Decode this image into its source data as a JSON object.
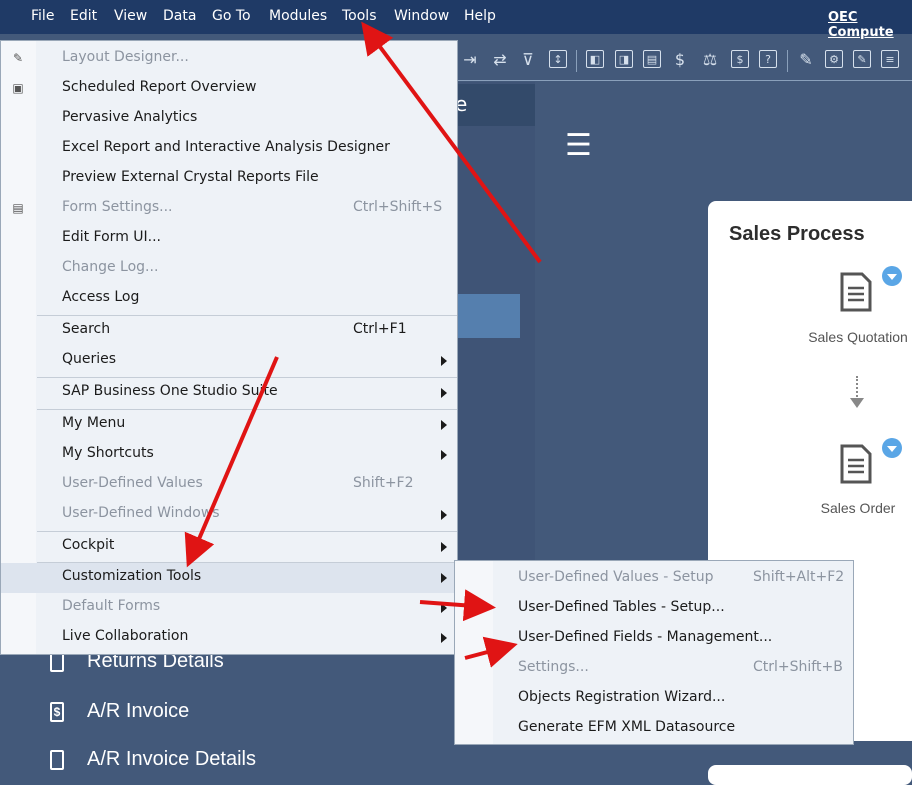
{
  "menubar": {
    "items": [
      {
        "label": "File"
      },
      {
        "label": "Edit"
      },
      {
        "label": "View"
      },
      {
        "label": "Data"
      },
      {
        "label": "Go To"
      },
      {
        "label": "Modules"
      },
      {
        "label": "Tools"
      },
      {
        "label": "Window"
      },
      {
        "label": "Help"
      }
    ],
    "company": "OEC Compute"
  },
  "colors": {
    "menubar_bg": "#1f3a66",
    "background": "#43597a",
    "menu_bg": "#eef2f7",
    "annotation_arrow": "#e01414",
    "badge": "#5aa6e6"
  },
  "tools_menu": {
    "items": [
      {
        "label": "Layout Designer...",
        "icon": "pencil-icon"
      },
      {
        "label": "Scheduled Report Overview",
        "icon": "report-schedule-icon"
      },
      {
        "label": "Pervasive Analytics"
      },
      {
        "label": "Excel Report and Interactive Analysis Designer"
      },
      {
        "label": "Preview External Crystal Reports File"
      },
      {
        "label": "Form Settings...",
        "shortcut": "Ctrl+Shift+S",
        "icon": "form-settings-icon"
      },
      {
        "label": "Edit Form UI..."
      },
      {
        "label": "Change Log..."
      },
      {
        "label": "Access Log"
      },
      {
        "label": "Search",
        "shortcut": "Ctrl+F1"
      },
      {
        "label": "Queries"
      },
      {
        "label": "SAP Business One Studio Suite"
      },
      {
        "label": "My Menu"
      },
      {
        "label": "My Shortcuts"
      },
      {
        "label": "User-Defined Values",
        "shortcut": "Shift+F2"
      },
      {
        "label": "User-Defined Windows"
      },
      {
        "label": "Cockpit"
      },
      {
        "label": "Customization Tools"
      },
      {
        "label": "Default Forms"
      },
      {
        "label": "Live Collaboration"
      }
    ]
  },
  "customization_submenu": {
    "items": [
      {
        "label": "User-Defined Values - Setup",
        "shortcut": "Shift+Alt+F2"
      },
      {
        "label": "User-Defined Tables - Setup..."
      },
      {
        "label": "User-Defined Fields - Management..."
      },
      {
        "label": "Settings...",
        "shortcut": "Ctrl+Shift+B"
      },
      {
        "label": "Objects Registration Wizard..."
      },
      {
        "label": "Generate EFM XML Datasource"
      }
    ]
  },
  "left_header": {
    "text": "e"
  },
  "sales_process": {
    "title": "Sales Process",
    "steps": [
      {
        "label": "Sales Quotation",
        "icon": "document-icon"
      },
      {
        "label": "Sales Order",
        "icon": "document-icon"
      }
    ]
  },
  "side_list": {
    "items": [
      {
        "label": "Returns Details",
        "icon": "document-icon"
      },
      {
        "label": "A/R Invoice",
        "icon": "dollar-document-icon"
      },
      {
        "label": "A/R Invoice Details",
        "icon": "document-icon"
      }
    ]
  }
}
